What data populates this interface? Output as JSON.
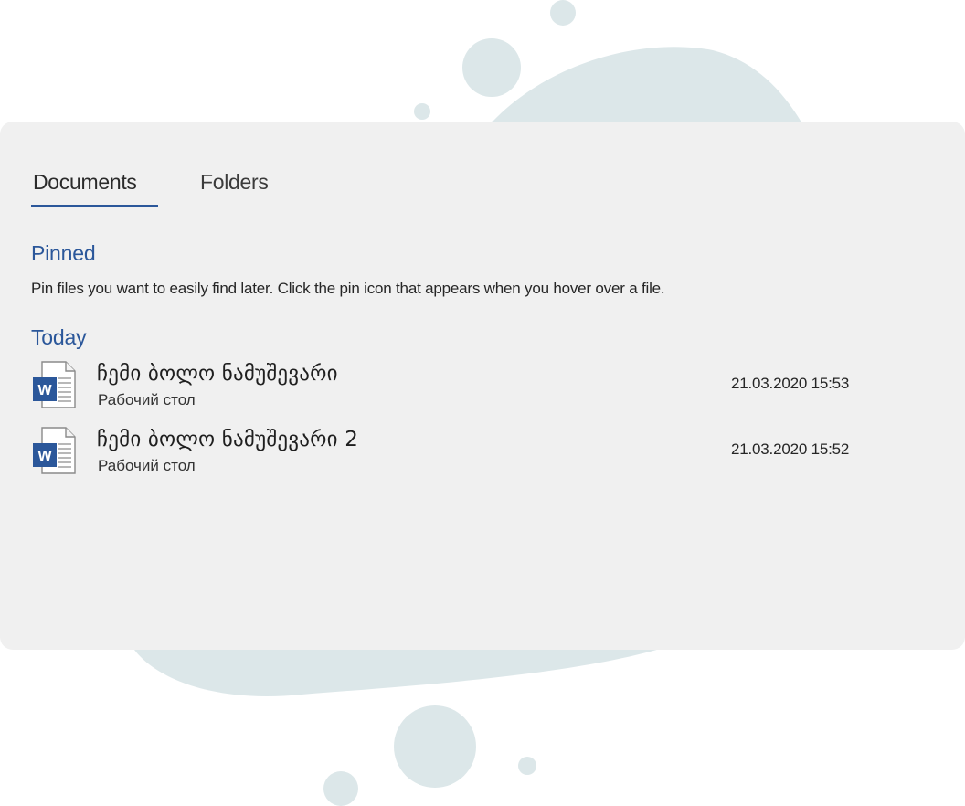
{
  "tabs": [
    {
      "label": "Documents",
      "active": true
    },
    {
      "label": "Folders",
      "active": false
    }
  ],
  "pinned": {
    "title": "Pinned",
    "description": "Pin files you want to easily find later. Click the pin icon that appears when you hover over a file."
  },
  "today": {
    "title": "Today",
    "files": [
      {
        "name": "ჩემი ბოლო ნამუშევარი",
        "location": "Рабочий стол",
        "date": "21.03.2020 15:53",
        "icon": "word-document-icon",
        "icon_letter": "W"
      },
      {
        "name": "ჩემი ბოლო ნამუშევარი 2",
        "location": "Рабочий стол",
        "date": "21.03.2020 15:52",
        "icon": "word-document-icon",
        "icon_letter": "W"
      }
    ]
  },
  "colors": {
    "accent": "#2b579a",
    "panel_bg": "#f0f0f0",
    "decoration": "#dce7e9"
  }
}
